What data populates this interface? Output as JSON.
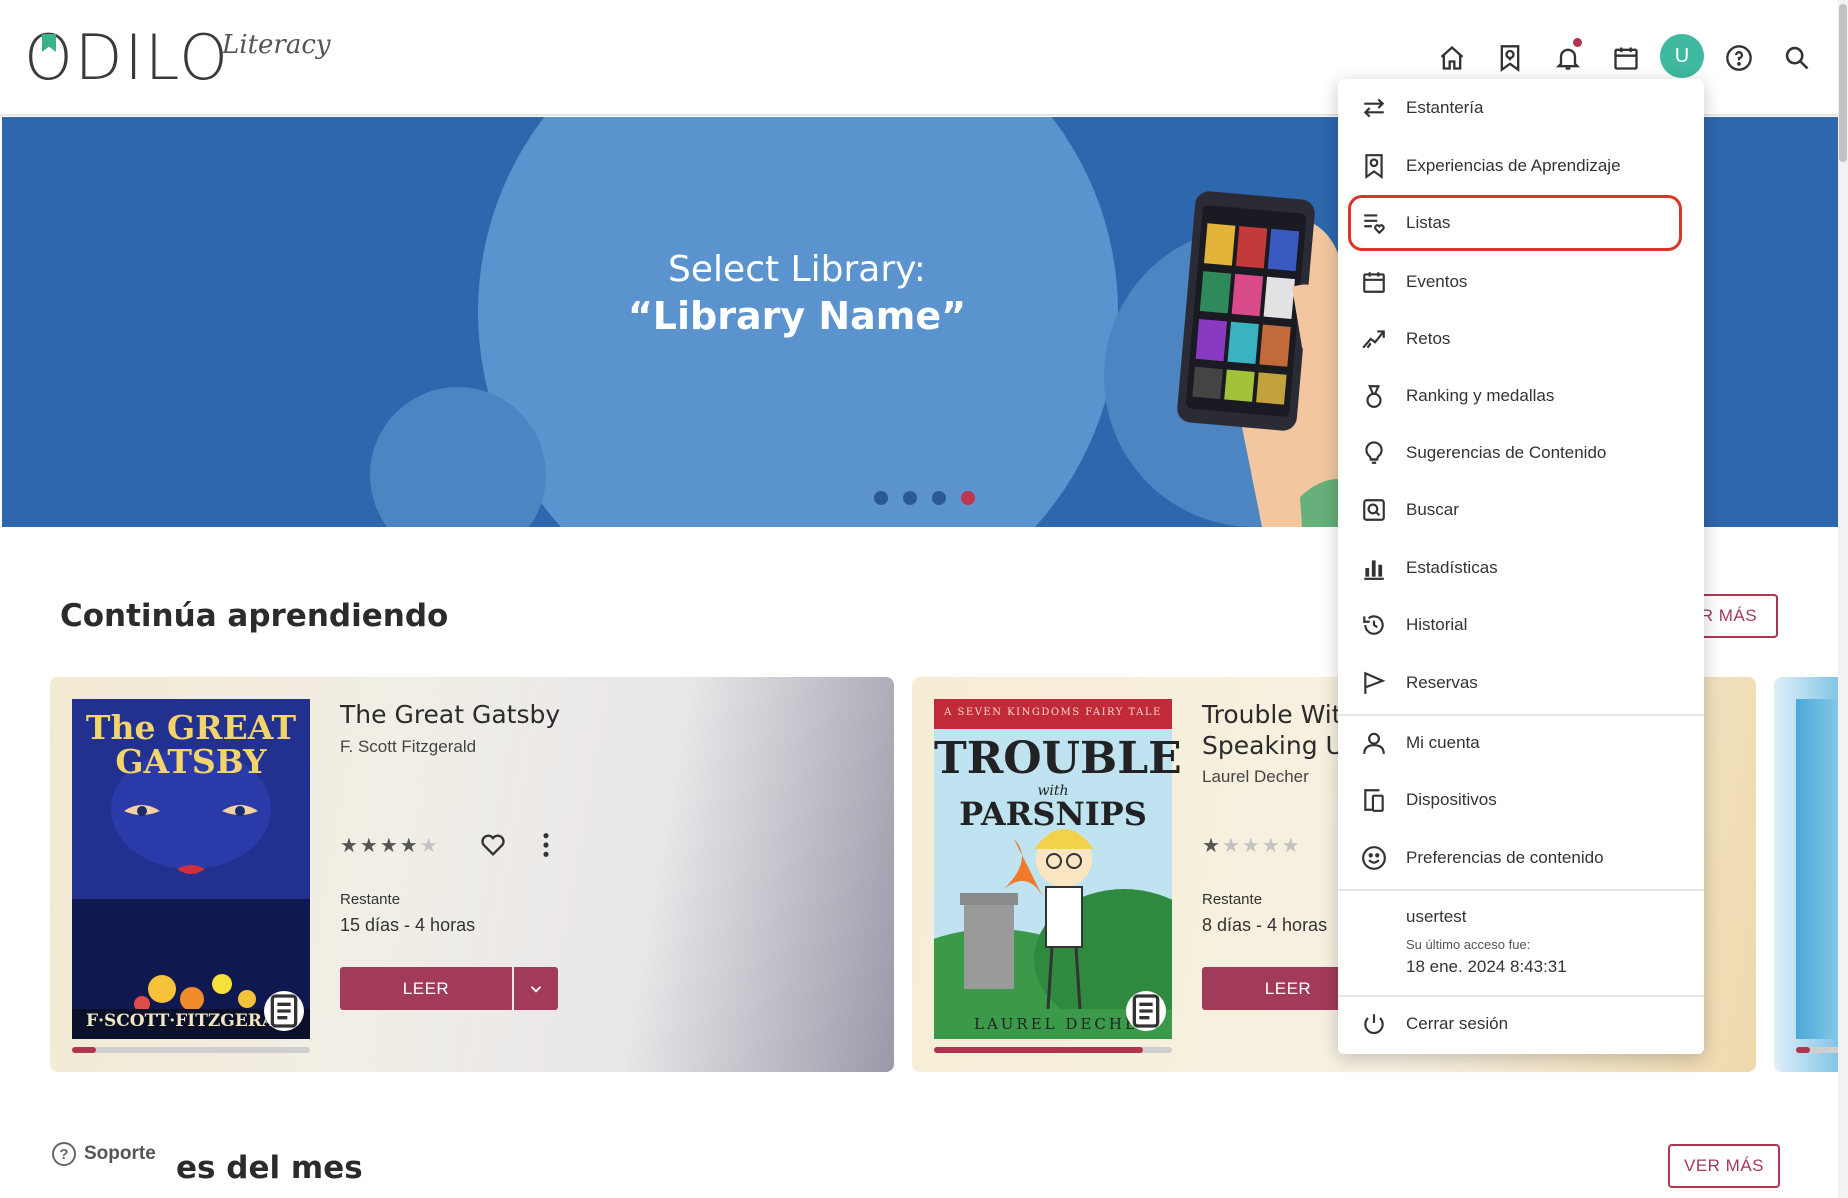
{
  "header": {
    "logo_text": "ODILO",
    "logo_sub": "Literacy",
    "avatar_initial": "U",
    "icons": [
      "home-icon",
      "learning-bookmark-icon",
      "bell-icon",
      "calendar-icon",
      "avatar",
      "help-icon",
      "search-icon"
    ]
  },
  "banner": {
    "line1": "Select Library:",
    "line2": "“Library Name”",
    "slides": 4,
    "active_slide": 4
  },
  "section1": {
    "title": "Continúa aprendiendo",
    "ver_mas": "ER MÁS"
  },
  "cards": [
    {
      "title": "The Great Gatsby",
      "author": "F. Scott Fitzgerald",
      "rating": 3.5,
      "remaining_label": "Restante",
      "remaining_value": "15 días - 4 horas",
      "button": "LEER",
      "progress": 0.1,
      "cover_title": "The GREAT GATSBY",
      "cover_author": "F·SCOTT·FITZGERALD"
    },
    {
      "title_line1": "Trouble With",
      "title_line2": "Speaking Up",
      "author": "Laurel Decher",
      "rating": 1,
      "remaining_label": "Restante",
      "remaining_value": "8 días - 4 horas",
      "button": "LEER",
      "progress": 0.88,
      "cover_series": "A SEVEN KINGDOMS FAIRY TALE",
      "cover_title1": "TROUBLE",
      "cover_with": "with",
      "cover_title2": "PARSNIPS",
      "cover_author": "LAUREL DECHER"
    }
  ],
  "section2": {
    "title_partial": "es del mes",
    "ver_mas": "VER MÁS",
    "soporte": "Soporte"
  },
  "menu": {
    "items": [
      {
        "label": "Estantería",
        "icon": "swap-arrows-icon"
      },
      {
        "label": "Experiencias de Aprendizaje",
        "icon": "learning-bookmark-icon"
      },
      {
        "label": "Listas",
        "icon": "list-heart-icon"
      },
      {
        "label": "Eventos",
        "icon": "calendar-icon"
      },
      {
        "label": "Retos",
        "icon": "challenge-arrow-icon"
      },
      {
        "label": "Ranking y medallas",
        "icon": "medal-icon"
      },
      {
        "label": "Sugerencias de Contenido",
        "icon": "lightbulb-icon"
      },
      {
        "label": "Buscar",
        "icon": "search-box-icon"
      },
      {
        "label": "Estadísticas",
        "icon": "bar-chart-icon"
      },
      {
        "label": "Historial",
        "icon": "history-icon"
      },
      {
        "label": "Reservas",
        "icon": "flag-icon"
      },
      {
        "label": "Mi cuenta",
        "icon": "user-icon"
      },
      {
        "label": "Dispositivos",
        "icon": "devices-icon"
      },
      {
        "label": "Preferencias de contenido",
        "icon": "smiley-icon"
      }
    ],
    "username": "usertest",
    "last_access_label": "Su último acceso fue:",
    "last_access_value": "18 ene. 2024 8:43:31",
    "logout": "Cerrar sesión",
    "highlighted": "Listas"
  },
  "colors": {
    "brand": "#a23a5a",
    "banner": "#2e67ad",
    "avatar": "#3fb9a0",
    "highlight": "#d9362b"
  }
}
